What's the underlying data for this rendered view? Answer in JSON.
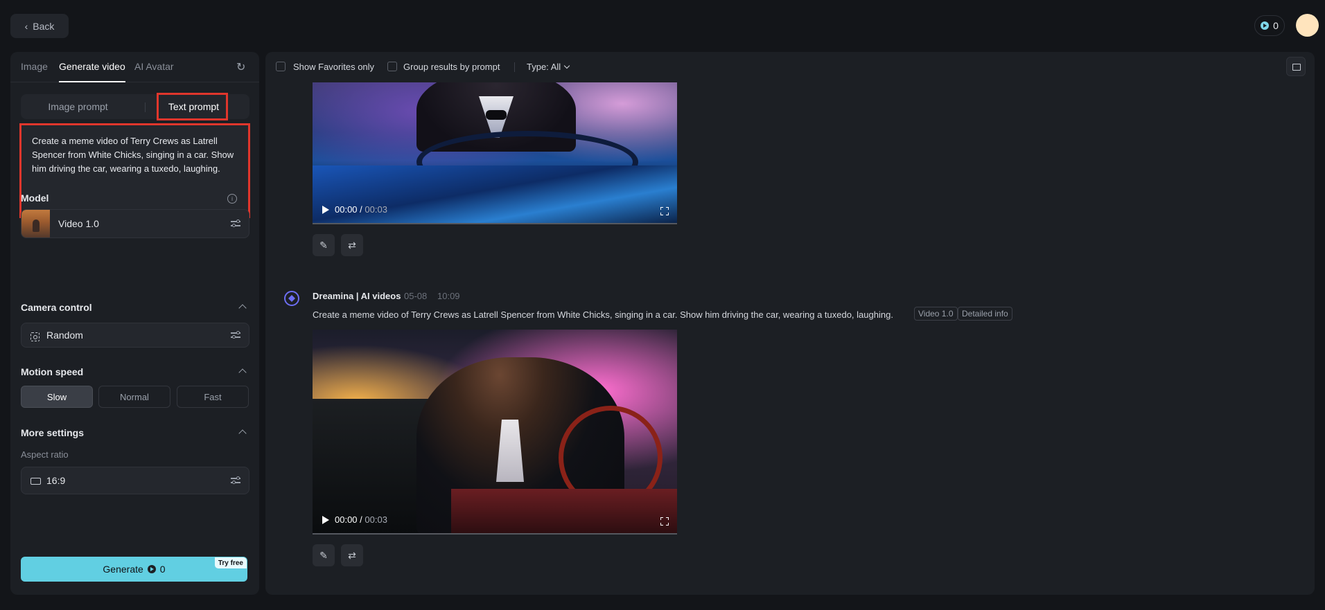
{
  "topbar": {
    "back_label": "Back",
    "credits": "0"
  },
  "left_tabs": [
    "Image",
    "Generate video",
    "AI Avatar"
  ],
  "prompt_mode": {
    "image_prompt": "Image prompt",
    "text_prompt": "Text prompt"
  },
  "prompt": {
    "text": "Create a meme video of Terry Crews as Latrell Spencer from White Chicks, singing in a car. Show him driving the car, wearing a tuxedo, laughing."
  },
  "model": {
    "label": "Model",
    "value": "Video 1.0"
  },
  "camera": {
    "label": "Camera control",
    "value": "Random"
  },
  "motion": {
    "label": "Motion speed",
    "options": [
      "Slow",
      "Normal",
      "Fast"
    ],
    "selected": "Slow"
  },
  "more": {
    "label": "More settings",
    "aspect_label": "Aspect ratio",
    "aspect_value": "16:9"
  },
  "generate": {
    "label": "Generate",
    "cost": "0",
    "badge": "Try free"
  },
  "filters": {
    "favorites": "Show Favorites only",
    "group": "Group results by prompt",
    "type": "Type: All"
  },
  "video1": {
    "time_current": "00:00",
    "time_total": "00:03"
  },
  "message": {
    "author": "Dreamina | AI videos",
    "date": "05-08",
    "time": "10:09",
    "caption": "Create a meme video of Terry Crews as Latrell Spencer from White Chicks, singing in a car. Show him driving the car, wearing a tuxedo, laughing.",
    "tag_model": "Video 1.0",
    "tag_info": "Detailed info"
  },
  "video2": {
    "time_current": "00:00",
    "time_total": "00:03"
  },
  "colors": {
    "accent": "#61cfe2",
    "highlight": "#e0362c",
    "bot": "#6d6ef3"
  },
  "icons": [
    "chevron-left-icon",
    "coin-icon",
    "refresh-icon",
    "info-icon",
    "sliders-icon",
    "camera-focus-icon",
    "aspect-ratio-icon",
    "chevron-up-icon",
    "chevron-down-icon",
    "folder-icon",
    "play-icon",
    "fullscreen-icon",
    "edit-icon",
    "regenerate-icon",
    "bot-avatar-icon"
  ]
}
